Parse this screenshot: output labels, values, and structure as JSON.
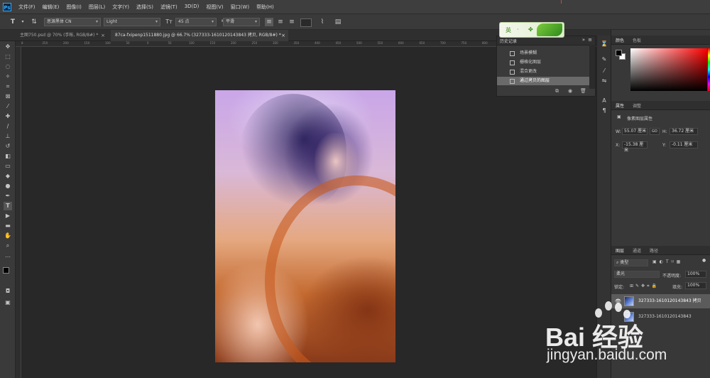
{
  "app": {
    "logo": "Ps"
  },
  "menu": [
    "文件(F)",
    "编辑(E)",
    "图像(I)",
    "图层(L)",
    "文字(Y)",
    "选择(S)",
    "滤镜(T)",
    "3D(D)",
    "视图(V)",
    "窗口(W)",
    "帮助(H)"
  ],
  "options": {
    "font_family": "思源黑体 CN",
    "font_style": "Light",
    "font_size": "45 点",
    "antialias": "平滑"
  },
  "tabs": [
    {
      "label": "主图750.psd @ 70% (手帐, RGB/8#) *",
      "active": false
    },
    {
      "label": "87ca-fxipenp1511880.jpg @ 66.7% (327333-1610120143843 拷贝, RGB/8#) *",
      "active": true
    }
  ],
  "ruler_ticks": [
    "8",
    "250",
    "200",
    "150",
    "100",
    "50",
    "0",
    "50",
    "100",
    "150",
    "200",
    "250",
    "300",
    "350",
    "400",
    "450",
    "500",
    "550",
    "600",
    "650",
    "700",
    "750",
    "800",
    "850",
    "900",
    "950",
    "1000",
    "1050"
  ],
  "history": {
    "title": "历史记录",
    "items": [
      "场景模糊",
      "栅格化图层",
      "混合更改",
      "通过拷贝的图层"
    ],
    "selected_index": 3
  },
  "ime": {
    "label": "英"
  },
  "color_panel": {
    "tabs": [
      "颜色",
      "色板"
    ],
    "fg": "#000000",
    "bg": "#ffffff"
  },
  "properties": {
    "tabs": [
      "属性",
      "调整"
    ],
    "title": "像素图层属性",
    "w_label": "W:",
    "w_value": "55.07 厘米",
    "h_label": "H:",
    "h_value": "36.72 厘米",
    "x_label": "X:",
    "x_value": "-15.38 厘米",
    "y_label": "Y:",
    "y_value": "-0.11 厘米",
    "link_label": "GO"
  },
  "layers": {
    "tabs": [
      "图层",
      "通道",
      "路径"
    ],
    "filter_label": "类型",
    "blend_mode": "柔光",
    "opacity_label": "不透明度:",
    "opacity_value": "100%",
    "lock_label": "锁定:",
    "fill_label": "填充:",
    "fill_value": "100%",
    "items": [
      {
        "name": "327333-1610120143843 拷贝",
        "active": true
      },
      {
        "name": "327333-1610120143843",
        "active": false
      }
    ]
  },
  "watermark": {
    "brand": "Bai  经验",
    "url": "jingyan.baidu.com"
  }
}
